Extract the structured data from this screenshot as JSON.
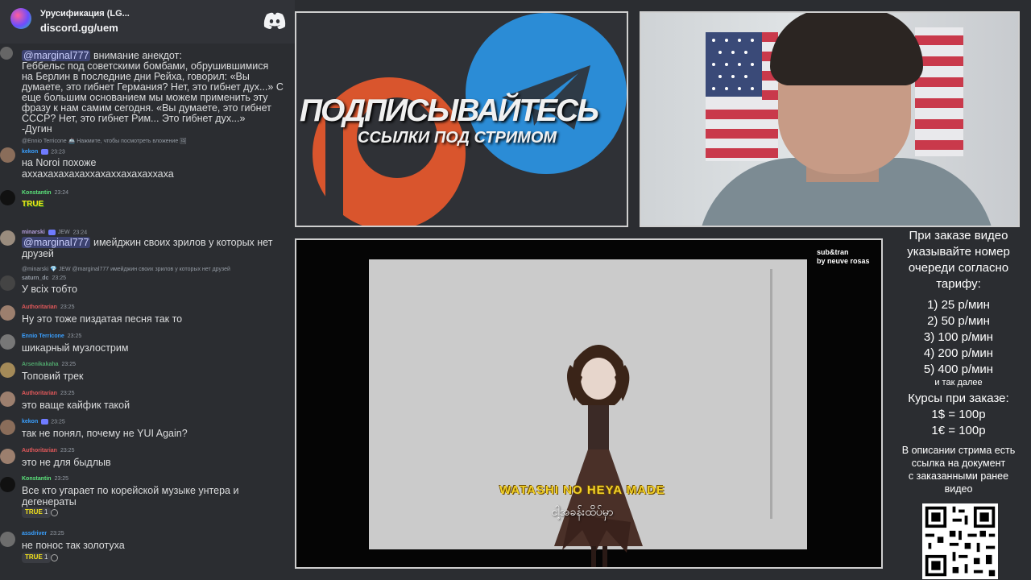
{
  "header": {
    "server_name": "Урусификация (LG...",
    "invite": "discord.gg/uem"
  },
  "chat": {
    "messages": [
      {
        "mention": "@marginal777",
        "lines": [
          "внимание анекдот:",
          "Геббельс под советскими бомбами, обрушившимися",
          "на Берлин в последние дни Рейха, говорил: «Вы",
          "думаете, это гибнет Германия? Нет, это гибнет дух...» С",
          "еще большим основанием мы можем применить эту",
          "фразу к нам самим сегодня. «Вы думаете, это гибнет",
          "СССР? Нет, это гибнет Рим... Это гибнет дух...»",
          "-Дугин"
        ]
      },
      {
        "reply": "@Ennio Terricone 🚢 Нажмите, чтобы посмотреть вложение 🖼",
        "user": "kekon",
        "time": "23:23",
        "text": "на Noroi похоже",
        "text2": "аххахахахахаххахаххахахаххаха"
      },
      {
        "user": "Konstantin",
        "time": "23:24",
        "emote": "TRUE"
      },
      {
        "user": "minarski",
        "badge": "JEW",
        "time": "23:24",
        "mention": "@marginal777",
        "text": "имейджин своих зрилов у которых нет",
        "text2": "друзей"
      },
      {
        "reply": "@minarski 💎 JEW @marginal777 имейджин своих зрилов у которых нет друзей",
        "user": "saturn_dc",
        "time": "23:25",
        "text": "У всіх тобто"
      },
      {
        "user": "Authoritarian",
        "time": "23:25",
        "text": "Ну это тоже пиздатая песня так то"
      },
      {
        "user": "Ennio Terricone",
        "time": "23:25",
        "text": "шикарный музлострим"
      },
      {
        "user": "Arsenikakaha",
        "time": "23:25",
        "text": "Топовий трек"
      },
      {
        "user": "Authoritarian",
        "time": "23:25",
        "text": "это ваще кайфик такой"
      },
      {
        "user": "kekon",
        "time": "23:25",
        "text": "так не понял, почему не YUI Again?"
      },
      {
        "user": "Authoritarian",
        "time": "23:25",
        "text": "это не для быдлыв"
      },
      {
        "user": "Konstantin",
        "time": "23:25",
        "text": "Все кто угарает по корейской музыке унтера и",
        "text2": "дегенераты",
        "reaction": "1"
      },
      {
        "user": "assdriver",
        "time": "23:25",
        "text": "не понос так золотуха",
        "reaction": "1"
      }
    ]
  },
  "banner": {
    "title": "ПОДПИСЫВАЙТЕСЬ",
    "subtitle": "ССЫЛКИ ПОД СТРИМОМ"
  },
  "video": {
    "credit_line1": "sub&tran",
    "credit_line2": "by neuve rosas",
    "lyric_main": "WATASHI NO HEYA MADE",
    "lyric_sub": "ငါ့အခန်းထိပ်မှာ"
  },
  "info": {
    "lines": [
      "При заказе видео",
      "указывайте номер",
      "очереди согласно",
      "тарифу:"
    ],
    "tariffs": [
      "1) 25 р/мин",
      "2) 50 р/мин",
      "3) 100 р/мин",
      "4) 200 р/мин",
      "5) 400 р/мин"
    ],
    "and_so_on": "и так далее",
    "rates_title": "Курсы при заказе:",
    "rates": [
      "1$ = 100р",
      "1€ = 100р"
    ],
    "note": [
      "В описании стрима есть",
      "ссылка на документ",
      "с заказанными ранее",
      "видео"
    ]
  },
  "colors": {
    "chat_bg": "#2b2d31",
    "mention_bg": "#3c4270",
    "patreon": "#d9552d",
    "telegram": "#2b8cd6",
    "lyric": "#f3d22a"
  }
}
